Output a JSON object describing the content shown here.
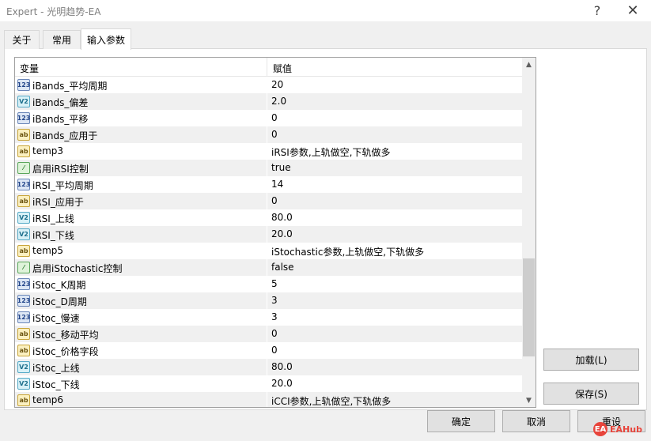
{
  "window": {
    "title": "Expert - 光明趋势-EA",
    "help_glyph": "?",
    "close_glyph": "✕"
  },
  "tabs": [
    {
      "label": "关于",
      "active": false
    },
    {
      "label": "常用",
      "active": false
    },
    {
      "label": "输入参数",
      "active": true
    }
  ],
  "grid": {
    "headers": {
      "variable": "变量",
      "value": "赋值"
    },
    "rows": [
      {
        "icon": "123",
        "icon_name": "integer-type-icon",
        "name": "iBands_平均周期",
        "value": "20"
      },
      {
        "icon": "V2",
        "icon_name": "double-type-icon",
        "name": "iBands_偏差",
        "value": "2.0"
      },
      {
        "icon": "123",
        "icon_name": "integer-type-icon",
        "name": "iBands_平移",
        "value": "0"
      },
      {
        "icon": "ab",
        "icon_name": "string-type-icon",
        "name": "iBands_应用于",
        "value": "0"
      },
      {
        "icon": "ab",
        "icon_name": "string-type-icon",
        "name": "temp3",
        "value": "iRSI参数,上轨做空,下轨做多"
      },
      {
        "icon": "⁄",
        "icon_name": "boolean-type-icon",
        "name": "启用iRSI控制",
        "value": "true"
      },
      {
        "icon": "123",
        "icon_name": "integer-type-icon",
        "name": "iRSI_平均周期",
        "value": "14"
      },
      {
        "icon": "ab",
        "icon_name": "string-type-icon",
        "name": "iRSI_应用于",
        "value": "0"
      },
      {
        "icon": "V2",
        "icon_name": "double-type-icon",
        "name": "iRSI_上线",
        "value": "80.0"
      },
      {
        "icon": "V2",
        "icon_name": "double-type-icon",
        "name": "iRSI_下线",
        "value": "20.0"
      },
      {
        "icon": "ab",
        "icon_name": "string-type-icon",
        "name": "temp5",
        "value": "iStochastic参数,上轨做空,下轨做多"
      },
      {
        "icon": "⁄",
        "icon_name": "boolean-type-icon",
        "name": "启用iStochastic控制",
        "value": "false"
      },
      {
        "icon": "123",
        "icon_name": "integer-type-icon",
        "name": "iStoc_K周期",
        "value": "5"
      },
      {
        "icon": "123",
        "icon_name": "integer-type-icon",
        "name": "iStoc_D周期",
        "value": "3"
      },
      {
        "icon": "123",
        "icon_name": "integer-type-icon",
        "name": "iStoc_慢速",
        "value": "3"
      },
      {
        "icon": "ab",
        "icon_name": "string-type-icon",
        "name": "iStoc_移动平均",
        "value": "0"
      },
      {
        "icon": "ab",
        "icon_name": "string-type-icon",
        "name": "iStoc_价格字段",
        "value": "0"
      },
      {
        "icon": "V2",
        "icon_name": "double-type-icon",
        "name": "iStoc_上线",
        "value": "80.0"
      },
      {
        "icon": "V2",
        "icon_name": "double-type-icon",
        "name": "iStoc_下线",
        "value": "20.0"
      },
      {
        "icon": "ab",
        "icon_name": "string-type-icon",
        "name": "temp6",
        "value": "iCCI参数,上轨做空,下轨做多"
      }
    ]
  },
  "scrollbar": {
    "up_glyph": "▲",
    "down_glyph": "▼"
  },
  "buttons": {
    "load": "加载(L)",
    "save": "保存(S)",
    "ok": "确定",
    "cancel": "取消",
    "reset": "重设"
  },
  "watermark": {
    "logo": "EA",
    "text": "EAHub"
  }
}
